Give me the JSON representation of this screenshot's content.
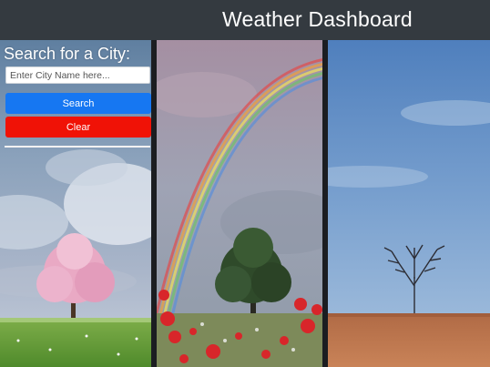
{
  "header": {
    "title": "Weather Dashboard"
  },
  "search": {
    "label": "Search for a City:",
    "placeholder": "Enter City Name here...",
    "value": "",
    "search_label": "Search",
    "clear_label": "Clear"
  },
  "colors": {
    "header_bg": "#343a40",
    "search_button": "#1677f2",
    "clear_button": "#f01206"
  }
}
